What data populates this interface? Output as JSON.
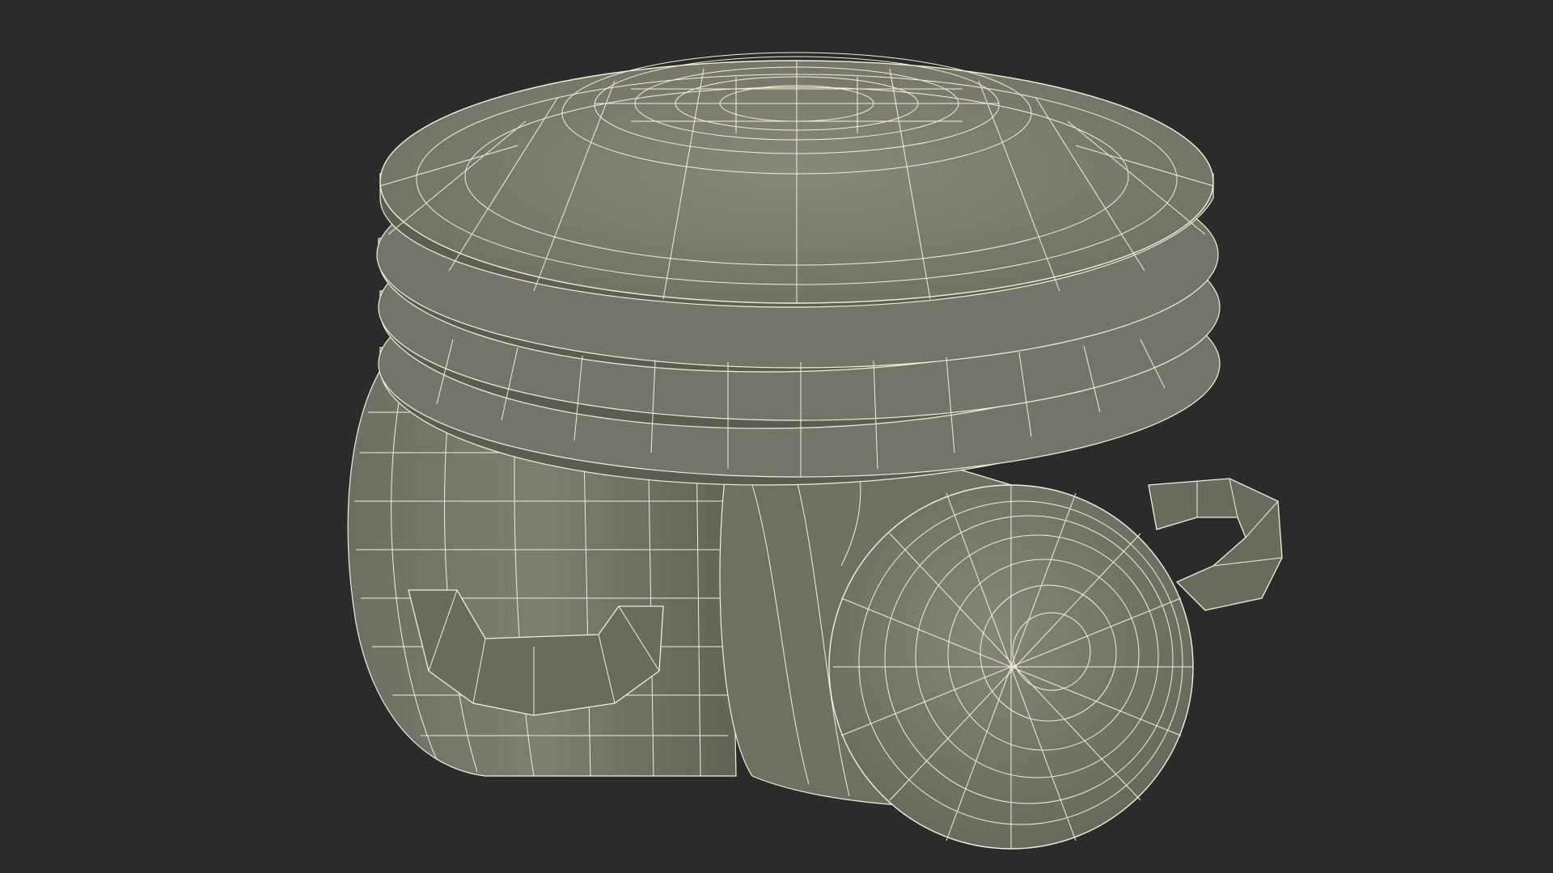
{
  "scene": {
    "subject": "wireframe-render",
    "background_color": "#2b2b2b",
    "surface_color": "#7a7b6e",
    "surface_dark_color": "#55564c",
    "surface_light_color": "#8a8b7e",
    "wire_color": "#f2f0d8",
    "objects": [
      {
        "name": "saucer-stack",
        "count": 4
      },
      {
        "name": "cup-upright"
      },
      {
        "name": "cup-tipped"
      }
    ]
  }
}
